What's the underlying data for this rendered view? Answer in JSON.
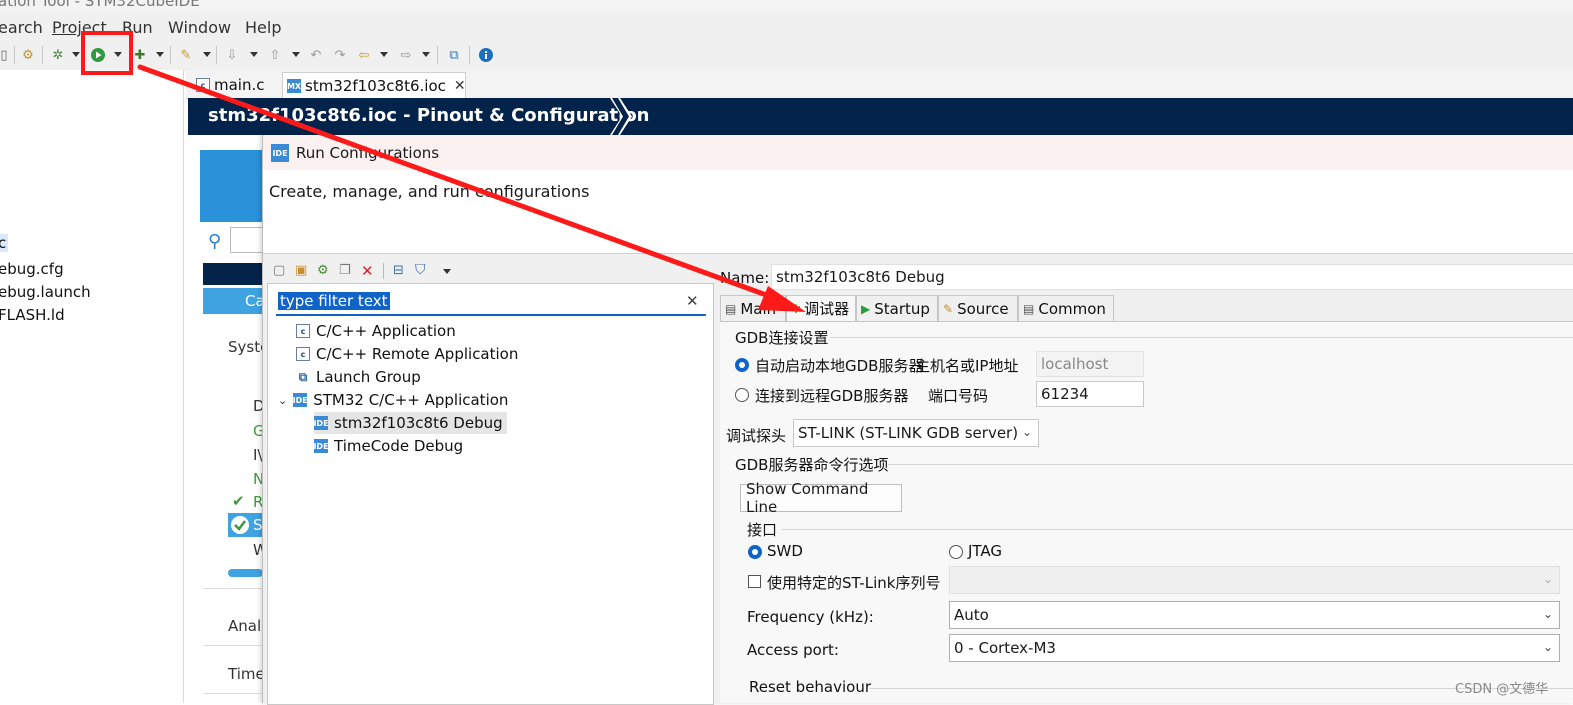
{
  "window": {
    "title_partial": "ation Tool - STM32CubeIDE"
  },
  "menu": [
    "earch",
    "Project",
    "Run",
    "Window",
    "Help"
  ],
  "toolbar": {
    "icons": [
      "save-icon",
      "debug-icon",
      "run-icon",
      "build-icon",
      "wrench-icon",
      "search-icon",
      "back-icon",
      "forward-icon",
      "info-icon"
    ]
  },
  "explorer": {
    "items": [
      "c",
      "ebug.cfg",
      "ebug.launch",
      "FLASH.ld"
    ]
  },
  "editor_tabs": [
    {
      "label": "main.c"
    },
    {
      "label": "stm32f103c8t6.ioc"
    }
  ],
  "cube": {
    "title": "stm32f103c8t6.ioc - Pinout & Configuration",
    "left_labels": [
      "Ca",
      "Syste",
      "D",
      "G",
      "I\\",
      "N",
      "R",
      "S",
      "W",
      "Anal",
      "Time"
    ]
  },
  "dialog": {
    "title": "Run Configurations",
    "banner": "Create, manage, and run configurations",
    "filter_placeholder": "type filter text",
    "tree": [
      {
        "label": "C/C++ Application",
        "icon": "c"
      },
      {
        "label": "C/C++ Remote Application",
        "icon": "c"
      },
      {
        "label": "Launch Group",
        "icon": "launch"
      },
      {
        "label": "STM32 C/C++ Application",
        "icon": "ide"
      },
      {
        "label": "stm32f103c8t6 Debug",
        "icon": "ide"
      },
      {
        "label": "TimeCode Debug",
        "icon": "ide"
      }
    ],
    "name_label": "Name:",
    "name_value": "stm32f103c8t6 Debug",
    "tabs": [
      "Main",
      "调试器",
      "Startup",
      "Source",
      "Common"
    ],
    "gdb_group": "GDB连接设置",
    "radio_local": "自动启动本地GDB服务器",
    "host_label": "主机名或IP地址",
    "host_value": "localhost",
    "radio_remote": "连接到远程GDB服务器",
    "port_label": "端口号码",
    "port_value": "61234",
    "probe_label": "调试探头",
    "probe_value": "ST-LINK (ST-LINK GDB server)",
    "gdb_opts_group": "GDB服务器命令行选项",
    "show_cmd_button": "Show Command Line",
    "interface_group": "接口",
    "swd": "SWD",
    "jtag": "JTAG",
    "serial_check": "使用特定的ST-Link序列号",
    "freq_label": "Frequency (kHz):",
    "freq_value": "Auto",
    "access_label": "Access port:",
    "access_value": "0 - Cortex-M3",
    "reset_group": "Reset behaviour"
  },
  "watermark": "CSDN @文德华",
  "colors": {
    "cube_header": "#03234b",
    "annotation": "#ff1a1a",
    "selection": "#1064c8"
  }
}
